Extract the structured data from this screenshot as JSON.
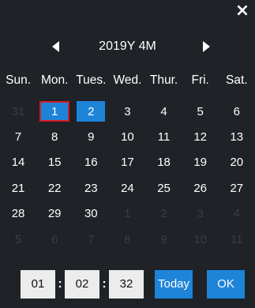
{
  "close_glyph": "×",
  "header": {
    "title": "2019Y 4M"
  },
  "weekdays": [
    "Sun.",
    "Mon.",
    "Tues.",
    "Wed.",
    "Thur.",
    "Fri.",
    "Sat."
  ],
  "days": [
    {
      "label": "31",
      "state": "other"
    },
    {
      "label": "1",
      "state": "selected"
    },
    {
      "label": "2",
      "state": "highlight"
    },
    {
      "label": "3",
      "state": "normal"
    },
    {
      "label": "4",
      "state": "normal"
    },
    {
      "label": "5",
      "state": "normal"
    },
    {
      "label": "6",
      "state": "normal"
    },
    {
      "label": "7",
      "state": "normal"
    },
    {
      "label": "8",
      "state": "normal"
    },
    {
      "label": "9",
      "state": "normal"
    },
    {
      "label": "10",
      "state": "normal"
    },
    {
      "label": "11",
      "state": "normal"
    },
    {
      "label": "12",
      "state": "normal"
    },
    {
      "label": "13",
      "state": "normal"
    },
    {
      "label": "14",
      "state": "normal"
    },
    {
      "label": "15",
      "state": "normal"
    },
    {
      "label": "16",
      "state": "normal"
    },
    {
      "label": "17",
      "state": "normal"
    },
    {
      "label": "18",
      "state": "normal"
    },
    {
      "label": "19",
      "state": "normal"
    },
    {
      "label": "20",
      "state": "normal"
    },
    {
      "label": "21",
      "state": "normal"
    },
    {
      "label": "22",
      "state": "normal"
    },
    {
      "label": "23",
      "state": "normal"
    },
    {
      "label": "24",
      "state": "normal"
    },
    {
      "label": "25",
      "state": "normal"
    },
    {
      "label": "26",
      "state": "normal"
    },
    {
      "label": "27",
      "state": "normal"
    },
    {
      "label": "28",
      "state": "normal"
    },
    {
      "label": "29",
      "state": "normal"
    },
    {
      "label": "30",
      "state": "normal"
    },
    {
      "label": "1",
      "state": "other"
    },
    {
      "label": "2",
      "state": "other"
    },
    {
      "label": "3",
      "state": "other"
    },
    {
      "label": "4",
      "state": "other"
    },
    {
      "label": "5",
      "state": "other"
    },
    {
      "label": "6",
      "state": "other"
    },
    {
      "label": "7",
      "state": "other"
    },
    {
      "label": "8",
      "state": "other"
    },
    {
      "label": "9",
      "state": "other"
    },
    {
      "label": "10",
      "state": "other"
    },
    {
      "label": "11",
      "state": "other"
    }
  ],
  "time": {
    "hours": "01",
    "minutes": "02",
    "seconds": "32",
    "separator": ":"
  },
  "buttons": {
    "today": "Today",
    "ok": "OK"
  },
  "colors": {
    "background": "#1f2227",
    "accent": "#1e84d8",
    "selected_border": "#d71c24",
    "other_month_text": "#3a3e44"
  },
  "icons": {
    "close": "close-icon",
    "prev": "triangle-left-icon",
    "next": "triangle-right-icon"
  }
}
